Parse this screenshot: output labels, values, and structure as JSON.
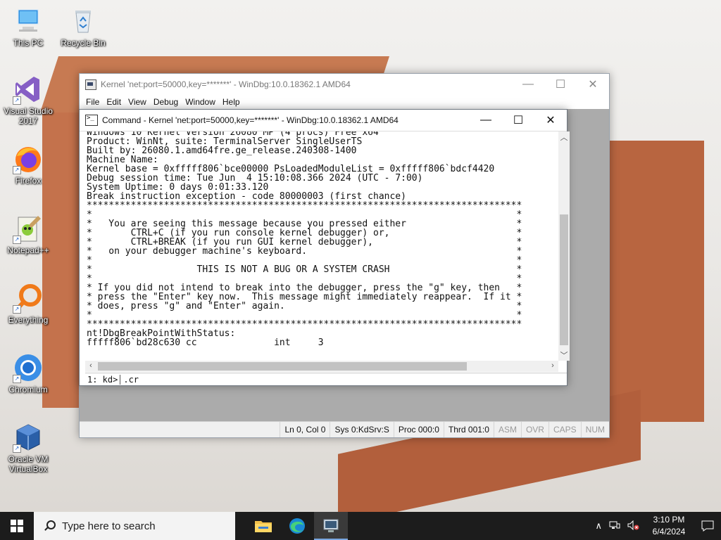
{
  "desktop": {
    "icons": [
      {
        "label": "This PC",
        "icon": "this-pc-icon"
      },
      {
        "label": "Recycle Bin",
        "icon": "recycle-bin-icon"
      },
      {
        "label": "Visual Studio 2017",
        "icon": "visual-studio-icon"
      },
      {
        "label": "Firefox",
        "icon": "firefox-icon"
      },
      {
        "label": "Notepad++",
        "icon": "notepadpp-icon"
      },
      {
        "label": "Everything",
        "icon": "everything-icon"
      },
      {
        "label": "Chromium",
        "icon": "chromium-icon"
      },
      {
        "label": "Oracle VM VirtualBox",
        "icon": "virtualbox-icon"
      }
    ]
  },
  "windbg": {
    "title": "Kernel 'net:port=50000,key=*******' - WinDbg:10.0.18362.1 AMD64",
    "menu": [
      "File",
      "Edit",
      "View",
      "Debug",
      "Window",
      "Help"
    ],
    "controls": {
      "minimize": "—",
      "maximize": "☐",
      "close": "✕"
    },
    "status": {
      "position": "Ln 0, Col 0",
      "sys": "Sys 0:KdSrv:S",
      "proc": "Proc 000:0",
      "thrd": "Thrd 001:0",
      "asm": "ASM",
      "ovr": "OVR",
      "caps": "CAPS",
      "num": "NUM"
    }
  },
  "command": {
    "title": "Command - Kernel 'net:port=50000,key=*******' - WinDbg:10.0.18362.1 AMD64",
    "controls": {
      "minimize": "—",
      "maximize": "☐",
      "close": "✕"
    },
    "output": "Windows 10 Kernel Version 26080 MP (4 procs) Free x64\nProduct: WinNt, suite: TerminalServer SingleUserTS\nBuilt by: 26080.1.amd64fre.ge_release.240308-1400\nMachine Name:\nKernel base = 0xfffff806`bce00000 PsLoadedModuleList = 0xfffff806`bdcf4420\nDebug session time: Tue Jun  4 15:10:08.366 2024 (UTC - 7:00)\nSystem Uptime: 0 days 0:01:33.120\nBreak instruction exception - code 80000003 (first chance)\n*******************************************************************************\n*                                                                             *\n*   You are seeing this message because you pressed either                    *\n*       CTRL+C (if you run console kernel debugger) or,                       *\n*       CTRL+BREAK (if you run GUI kernel debugger),                          *\n*   on your debugger machine's keyboard.                                      *\n*                                                                             *\n*                   THIS IS NOT A BUG OR A SYSTEM CRASH                       *\n*                                                                             *\n* If you did not intend to break into the debugger, press the \"g\" key, then   *\n* press the \"Enter\" key now.  This message might immediately reappear.  If it *\n* does, press \"g\" and \"Enter\" again.                                          *\n*                                                                             *\n*******************************************************************************\nnt!DbgBreakPointWithStatus:\nfffff806`bd28c630 cc              int     3",
    "prompt": "1: kd>",
    "input_value": ".cr"
  },
  "taskbar": {
    "search_placeholder": "Type here to search",
    "apps": [
      {
        "name": "File Explorer",
        "icon": "file-explorer-icon"
      },
      {
        "name": "Microsoft Edge",
        "icon": "edge-icon"
      },
      {
        "name": "WinDbg",
        "icon": "windbg-icon",
        "active": true
      }
    ],
    "tray": {
      "chevron": "∧",
      "time": "3:10 PM",
      "date": "6/4/2024"
    }
  }
}
